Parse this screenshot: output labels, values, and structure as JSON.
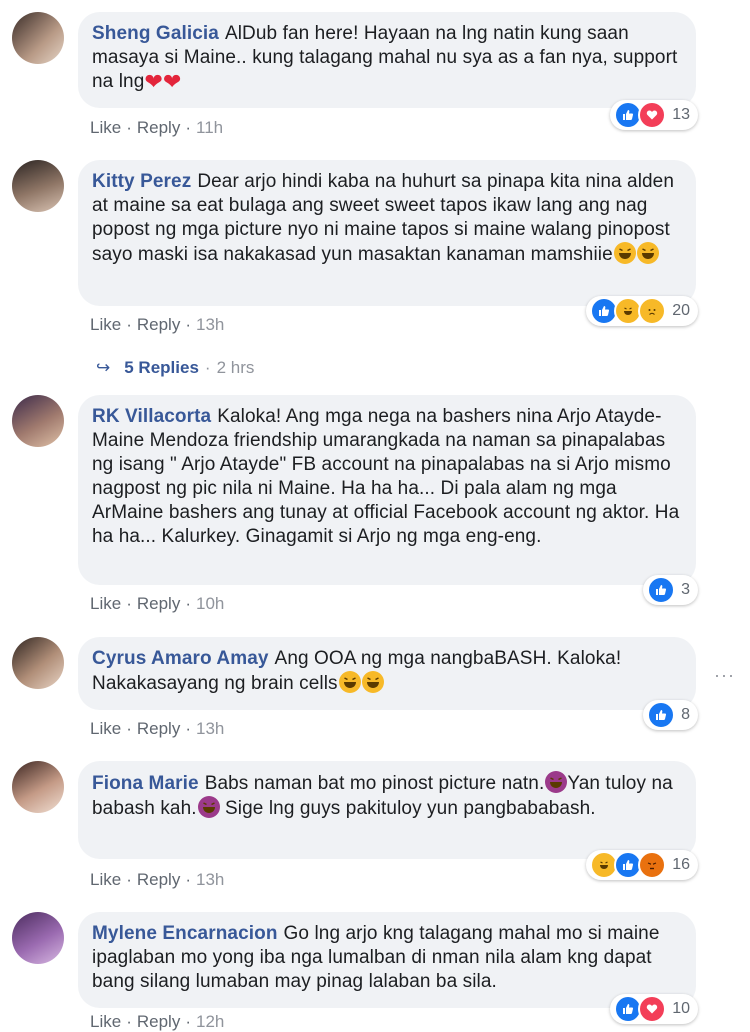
{
  "actions": {
    "like": "Like",
    "reply": "Reply"
  },
  "comments": [
    {
      "name": "Sheng Galicia",
      "text": "AlDub fan here! Hayaan na lng natin kung saan masaya si Maine.. kung talagang mahal nu sya as a fan nya, support na lng",
      "time": "11h",
      "react_count": "13",
      "reactions": [
        "like",
        "love"
      ],
      "inline_emoji": "heart"
    },
    {
      "name": "Kitty Perez",
      "text": "Dear arjo hindi kaba na huhurt sa pinapa kita nina alden at maine sa eat bulaga ang sweet sweet tapos ikaw lang ang nag popost ng mga picture nyo ni maine tapos si maine walang pinopost sayo maski isa nakakasad yun masaktan kanaman mamshiie",
      "time": "13h",
      "react_count": "20",
      "reactions": [
        "like",
        "haha",
        "sad"
      ],
      "inline_emoji": "haha"
    },
    {
      "name": "RK Villacorta",
      "text": "Kaloka! Ang mga nega na bashers nina Arjo Atayde-Maine Mendoza friendship umarangkada na naman sa pinapalabas ng isang \" Arjo Atayde\" FB account na pinapalabas na si Arjo mismo nagpost ng pic nila ni Maine. Ha ha ha... Di pala alam ng mga ArMaine bashers ang tunay at official Facebook account ng aktor. Ha ha ha... Kalurkey. Ginagamit si Arjo ng mga eng-eng.",
      "time": "10h",
      "react_count": "3",
      "reactions": [
        "like"
      ],
      "inline_emoji": ""
    },
    {
      "name": "Cyrus Amaro Amay",
      "text": "Ang OOA ng mga nangbaBASH. Kaloka! Nakakasayang ng brain cells",
      "time": "13h",
      "react_count": "8",
      "reactions": [
        "like"
      ],
      "inline_emoji": "haha"
    },
    {
      "name": "Fiona Marie",
      "text_a": "Babs naman bat mo pinost picture natn.",
      "text_b": "Yan tuloy na babash kah.",
      "text_c": "Sige lng guys pakituloy yun pangbababash.",
      "time": "13h",
      "react_count": "16",
      "reactions": [
        "haha",
        "like",
        "angry"
      ],
      "inline_emoji": "devil"
    },
    {
      "name": "Mylene Encarnacion",
      "text": "Go lng arjo kng talagang mahal mo si maine ipaglaban mo yong iba nga lumalban di nman nila alam kng dapat bang silang lumaban may pinag lalaban ba sila.",
      "time": "12h",
      "react_count": "10",
      "reactions": [
        "like",
        "love"
      ],
      "inline_emoji": ""
    }
  ],
  "replies": {
    "label": "5 Replies",
    "time": "2 hrs"
  },
  "more_icon": "···",
  "colors": {
    "name": "#385898",
    "bubble": "#f0f2f5",
    "meta": "#606770",
    "like": "#1877f2",
    "love": "#f33e58"
  }
}
